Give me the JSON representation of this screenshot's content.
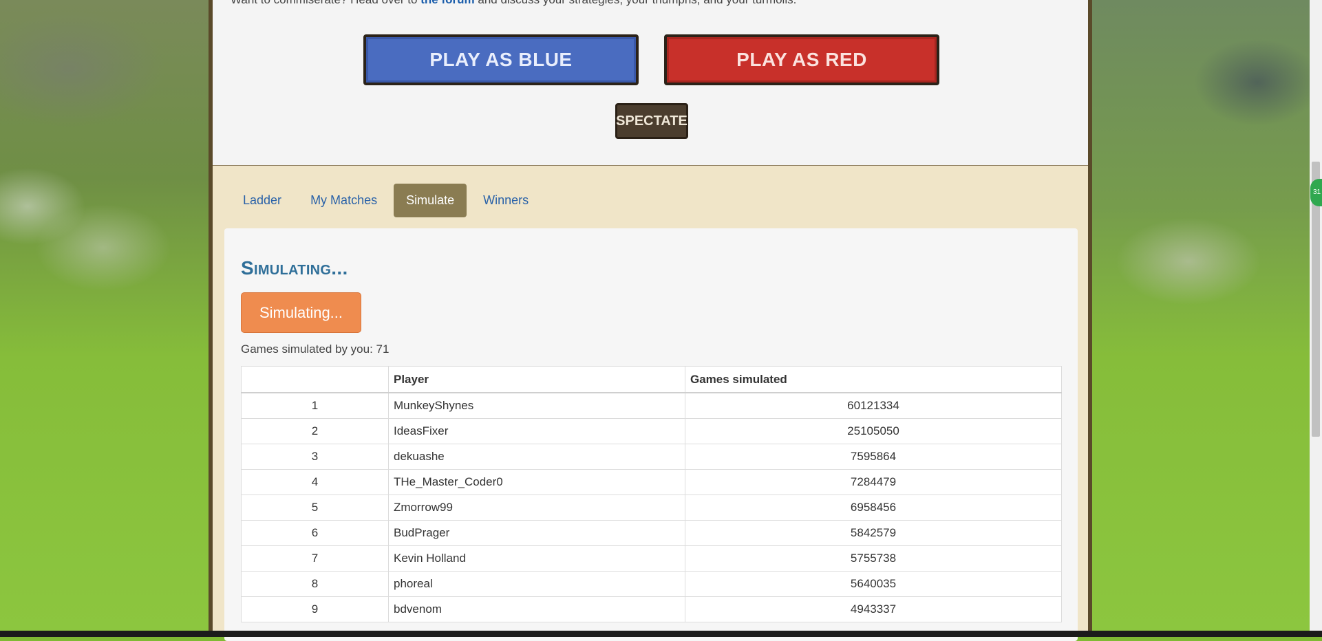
{
  "intro": {
    "prefix": "Want to commiserate? Head over to",
    "link": "the forum",
    "suffix": "and discuss your strategies, your triumphs, and your turmoils."
  },
  "buttons": {
    "play_blue": "PLAY AS BLUE",
    "play_red": "PLAY AS RED",
    "spectate": "SPECTATE"
  },
  "tabs": [
    {
      "label": "Ladder",
      "active": false
    },
    {
      "label": "My Matches",
      "active": false
    },
    {
      "label": "Simulate",
      "active": true
    },
    {
      "label": "Winners",
      "active": false
    }
  ],
  "simulate": {
    "heading": "Simulating...",
    "button_label": "Simulating...",
    "count_label": "Games simulated by you: 71"
  },
  "table": {
    "headers": [
      "",
      "Player",
      "Games simulated"
    ],
    "rows": [
      {
        "rank": "1",
        "player": "MunkeyShynes",
        "games": "60121334"
      },
      {
        "rank": "2",
        "player": "IdeasFixer",
        "games": "25105050"
      },
      {
        "rank": "3",
        "player": "dekuashe",
        "games": "7595864"
      },
      {
        "rank": "4",
        "player": "THe_Master_Coder0",
        "games": "7284479"
      },
      {
        "rank": "5",
        "player": "Zmorrow99",
        "games": "6958456"
      },
      {
        "rank": "6",
        "player": "BudPrager",
        "games": "5842579"
      },
      {
        "rank": "7",
        "player": "Kevin Holland",
        "games": "5755738"
      },
      {
        "rank": "8",
        "player": "phoreal",
        "games": "5640035"
      },
      {
        "rank": "9",
        "player": "bdvenom",
        "games": "4943337"
      }
    ]
  },
  "badge": "31",
  "colors": {
    "blue_button": "#4a6cc0",
    "red_button": "#c8302a",
    "simulate_button": "#ef8c4f",
    "active_tab": "#8a7c52",
    "link": "#1a5dab"
  }
}
